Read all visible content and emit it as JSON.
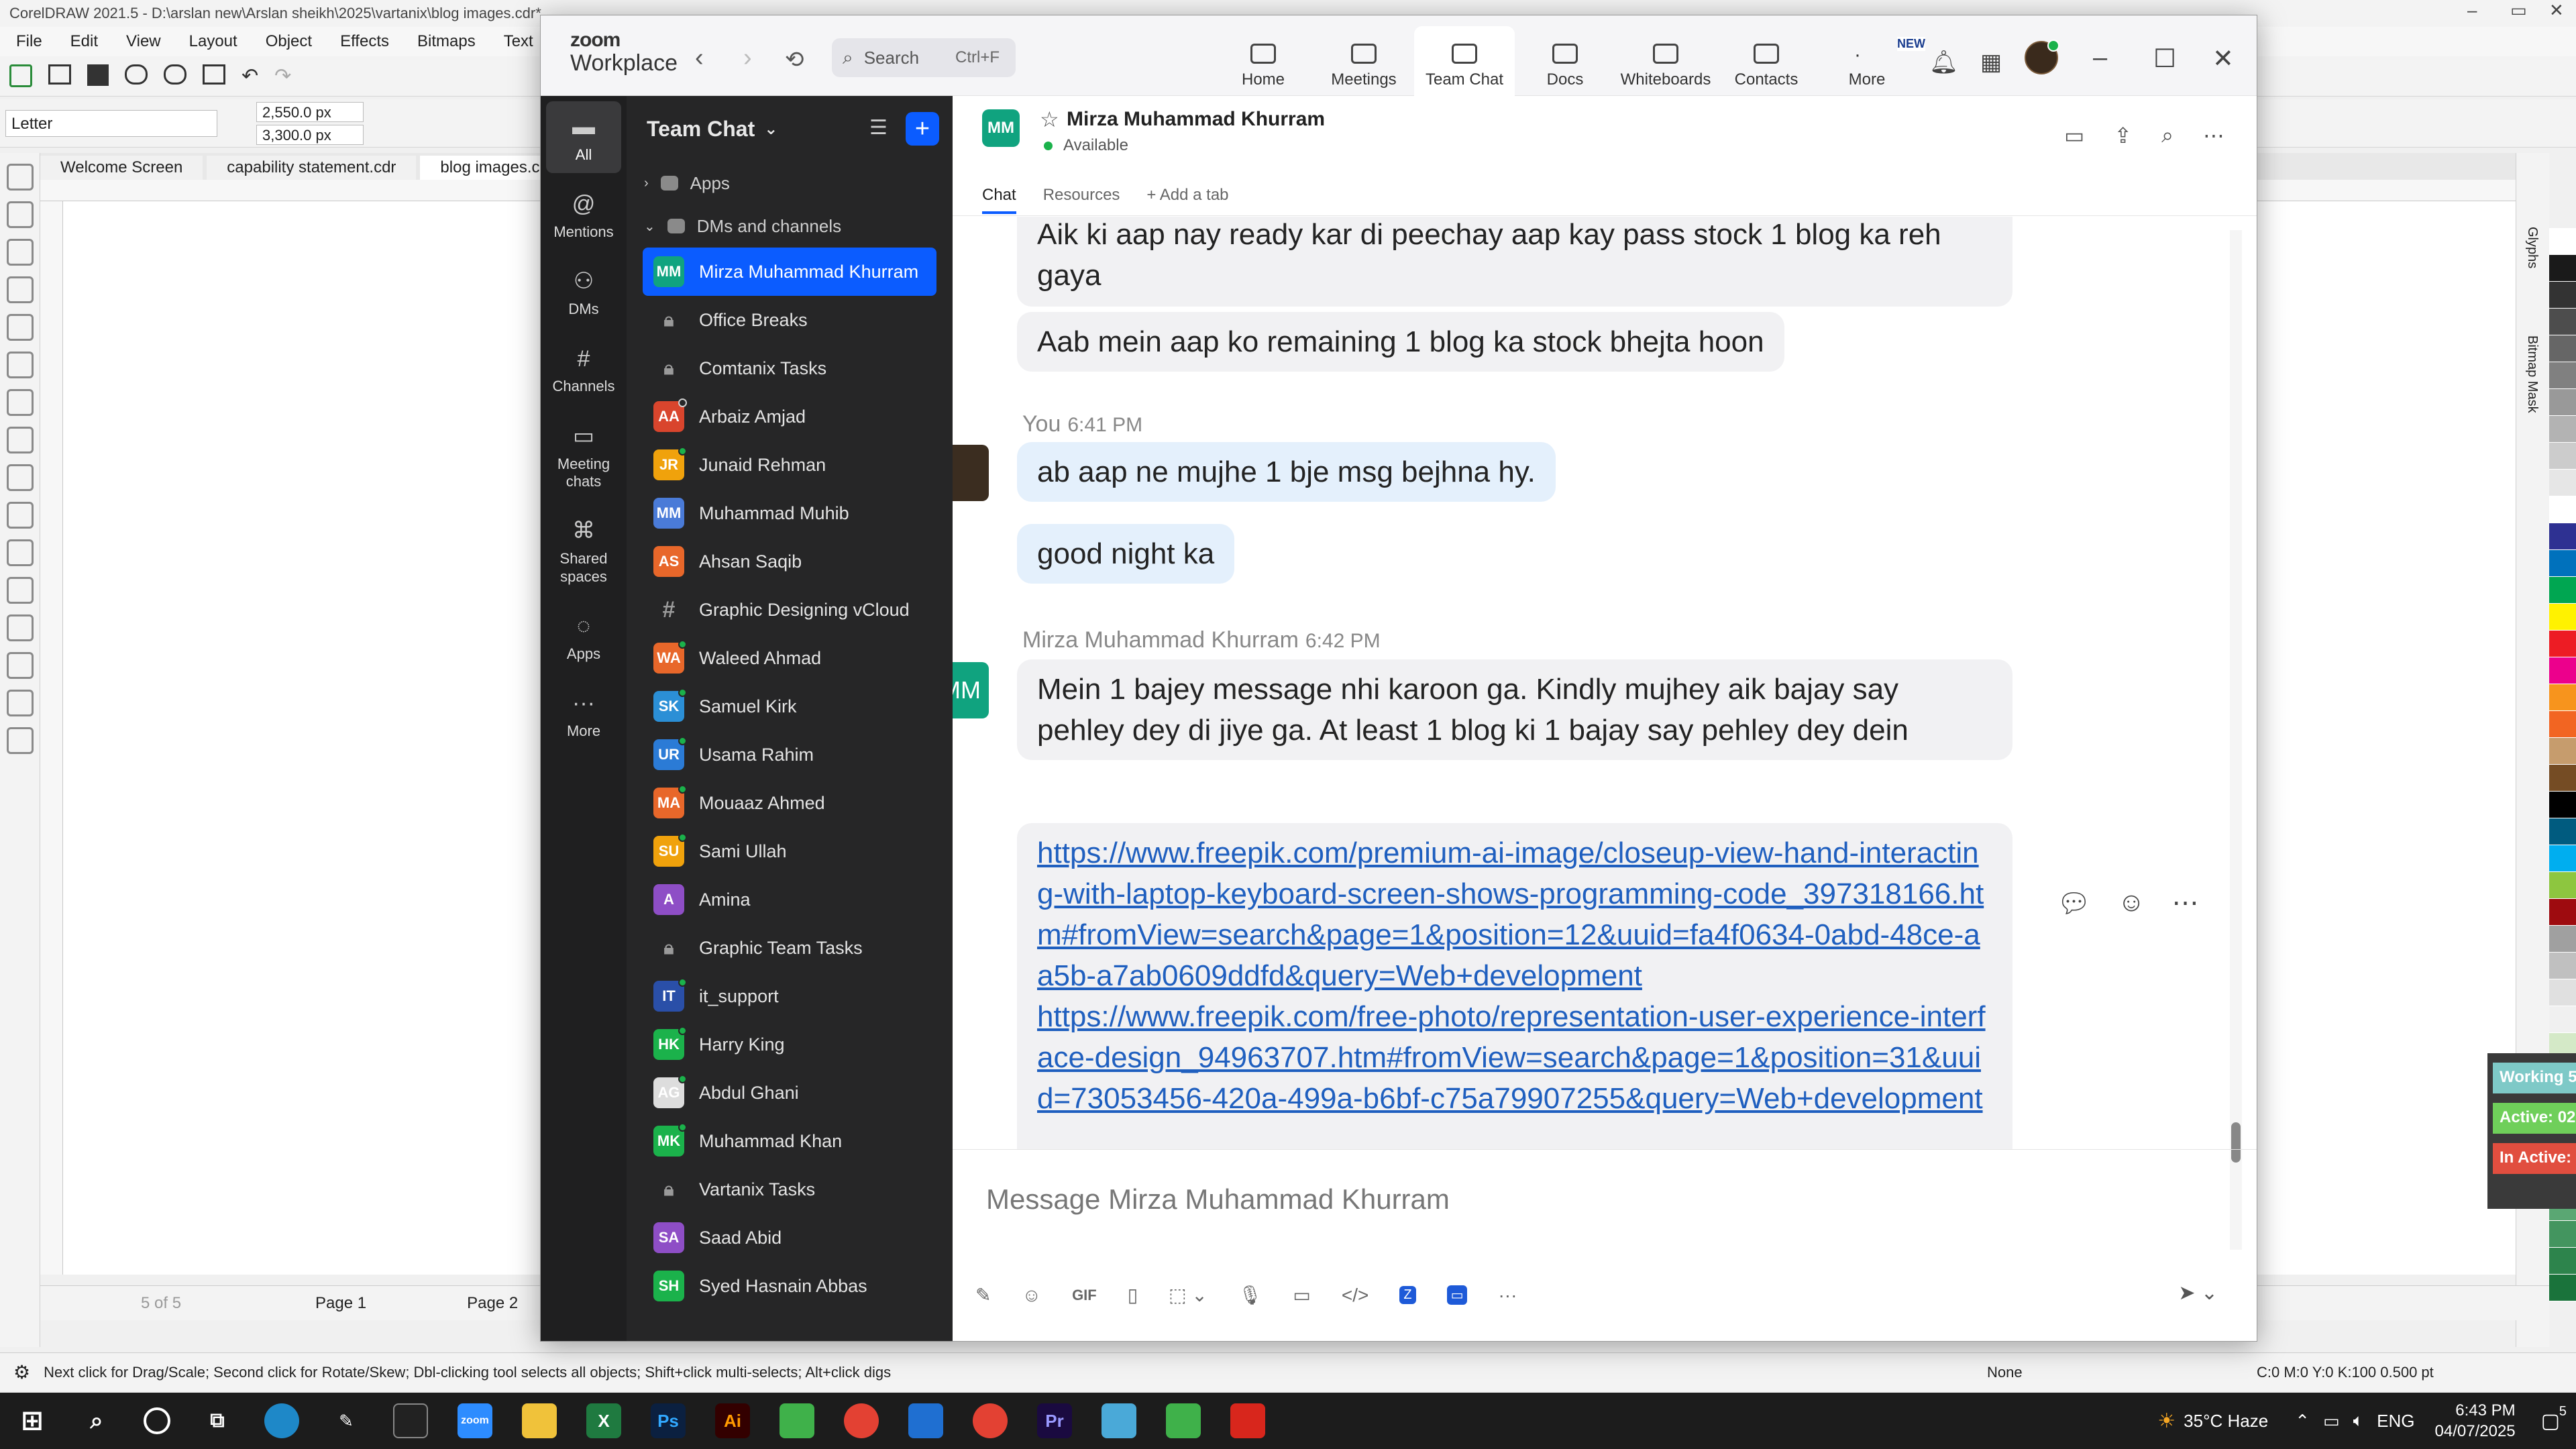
{
  "coreldraw": {
    "title": "CorelDRAW 2021.5 - D:\\arslan new\\Arslan sheikh\\2025\\vartanix\\blog images.cdr*",
    "menu": [
      "File",
      "Edit",
      "View",
      "Layout",
      "Object",
      "Effects",
      "Bitmaps",
      "Text"
    ],
    "page_size": "Letter",
    "width": "2,550.0 px",
    "height": "3,300.0 px",
    "tabs": [
      "Welcome Screen",
      "capability statement.cdr",
      "blog images.cdr*"
    ],
    "page_counter": "5 of 5",
    "page_tabs": [
      "Page 1",
      "Page 2"
    ],
    "status_hint": "Next click for Drag/Scale; Second click for Rotate/Skew; Dbl-clicking tool selects all objects; Shift+click multi-selects; Alt+click digs",
    "fill": "None",
    "outline": "C:0 M:0 Y:0 K:100  0.500 pt",
    "right_dock_labels": [
      "Glyphs",
      "Bitmap Mask"
    ],
    "palette_colors": [
      "#ffffff",
      "#1a1a1a",
      "#333333",
      "#4d4d4d",
      "#666666",
      "#808080",
      "#999999",
      "#b3b3b3",
      "#cccccc",
      "#e6e6e6",
      "#ffffff",
      "#2e3192",
      "#0071bc",
      "#00a651",
      "#fff200",
      "#ed1c24",
      "#ec008c",
      "#f7941d",
      "#f26522",
      "#c69c6d",
      "#754c24",
      "#000000",
      "#005b7f",
      "#00aeef",
      "#8dc63f",
      "#9e0b0f",
      "#a0a0a0",
      "#c0c0c0",
      "#e0e0e0",
      "#f0f0f0",
      "#d4e9c7",
      "#cfe6d0",
      "#b6dcd0",
      "#9bcfb8",
      "#8cc49f",
      "#73b889",
      "#5aa773",
      "#43955f",
      "#2d844c",
      "#1a733b"
    ],
    "floating_labels": [
      "Working 5",
      "Active: 02",
      "In Active:"
    ]
  },
  "taskbar": {
    "weather": "35°C Haze",
    "lang": "ENG",
    "time": "6:43 PM",
    "date": "04/07/2025",
    "notifications": "5",
    "apps": [
      "windows-start",
      "search",
      "cortana",
      "task-view",
      "edge",
      "pen",
      "terminal",
      "zoom",
      "explorer",
      "excel",
      "photoshop",
      "illustrator",
      "coreldraw",
      "chrome",
      "vscode",
      "chrome-profile",
      "premiere",
      "app",
      "corel-green",
      "acrobat"
    ]
  },
  "zoom": {
    "logo_top": "zoom",
    "logo_bottom": "Workplace",
    "search_label": "Search",
    "search_shortcut": "Ctrl+F",
    "nav": [
      {
        "label": "Home"
      },
      {
        "label": "Meetings"
      },
      {
        "label": "Team Chat"
      },
      {
        "label": "Docs"
      },
      {
        "label": "Whiteboards"
      },
      {
        "label": "Contacts"
      },
      {
        "label": "More"
      }
    ],
    "new_badge": "NEW",
    "rail": [
      {
        "label": "All",
        "icon": "chat-icon"
      },
      {
        "label": "Mentions",
        "icon": "at-icon"
      },
      {
        "label": "DMs",
        "icon": "people-icon"
      },
      {
        "label": "Channels",
        "icon": "hash-icon"
      },
      {
        "label": "Meeting chats",
        "icon": "calendar-icon"
      },
      {
        "label": "Shared spaces",
        "icon": "shared-icon"
      },
      {
        "label": "Apps",
        "icon": "apps-icon"
      },
      {
        "label": "More",
        "icon": "more-icon"
      }
    ],
    "list_title": "Team Chat",
    "sections": {
      "apps": "Apps",
      "dms": "DMs and channels"
    },
    "contacts": [
      {
        "name": "Mirza Muhammad Khurram",
        "initials": "MM",
        "color": "#10a37f",
        "kind": "avatar",
        "status": "none",
        "active": true
      },
      {
        "name": "Office Breaks",
        "kind": "lock"
      },
      {
        "name": "Comtanix Tasks",
        "kind": "lock"
      },
      {
        "name": "Arbaiz Amjad",
        "initials": "AA",
        "color": "#d9452d",
        "kind": "avatar",
        "status": "away"
      },
      {
        "name": "Junaid Rehman",
        "initials": "JR",
        "color": "#f0a20c",
        "kind": "avatar",
        "status": "online"
      },
      {
        "name": "Muhammad Muhib",
        "initials": "MM",
        "color": "#4a7bd8",
        "kind": "avatar",
        "status": "none"
      },
      {
        "name": "Ahsan Saqib",
        "initials": "AS",
        "color": "#e8672a",
        "kind": "avatar",
        "status": "none"
      },
      {
        "name": "Graphic Designing vCloud",
        "kind": "hash"
      },
      {
        "name": "Waleed Ahmad",
        "initials": "WA",
        "color": "#e8672a",
        "kind": "avatar",
        "status": "online"
      },
      {
        "name": "Samuel Kirk",
        "initials": "SK",
        "color": "#2b8fd6",
        "kind": "avatar",
        "status": "online"
      },
      {
        "name": "Usama Rahim",
        "initials": "UR",
        "color": "#2b7bd6",
        "kind": "avatar",
        "status": "online"
      },
      {
        "name": "Mouaaz Ahmed",
        "initials": "MA",
        "color": "#e8672a",
        "kind": "avatar",
        "status": "online"
      },
      {
        "name": "Sami Ullah",
        "initials": "SU",
        "color": "#f0a20c",
        "kind": "avatar",
        "status": "online"
      },
      {
        "name": "Amina",
        "initials": "A",
        "color": "#8e4ec6",
        "kind": "avatar",
        "status": "none"
      },
      {
        "name": "Graphic Team Tasks",
        "kind": "lock"
      },
      {
        "name": "it_support",
        "initials": "IT",
        "color": "#2a4fa8",
        "kind": "avatar",
        "status": "online"
      },
      {
        "name": "Harry King",
        "initials": "HK",
        "color": "#1bb24b",
        "kind": "avatar",
        "status": "online"
      },
      {
        "name": "Abdul Ghani",
        "initials": "AG",
        "color": "#dddddd",
        "kind": "avatar",
        "status": "online"
      },
      {
        "name": "Muhammad Khan",
        "initials": "MK",
        "color": "#1bb24b",
        "kind": "avatar",
        "status": "online"
      },
      {
        "name": "Vartanix Tasks",
        "kind": "lock"
      },
      {
        "name": "Saad Abid",
        "initials": "SA",
        "color": "#8e4ec6",
        "kind": "avatar",
        "status": "none"
      },
      {
        "name": "Syed Hasnain Abbas",
        "initials": "SH",
        "color": "#1bb24b",
        "kind": "avatar",
        "status": "none"
      }
    ],
    "chat": {
      "header_initials": "MM",
      "header_name": "Mirza Muhammad Khurram",
      "header_status": "Available",
      "tabs": [
        "Chat",
        "Resources",
        "+ Add a tab"
      ],
      "messages": {
        "m1": "Aik ki aap nay ready kar di peechay aap kay pass stock 1 blog ka reh gaya",
        "m2": "Aab mein aap ko remaining 1 blog ka stock bhejta hoon",
        "you_name": "You",
        "you_time": "6:41 PM",
        "m3": "ab aap ne mujhe 1 bje msg bejhna hy.",
        "m4": "good night ka",
        "other_name": "Mirza Muhammad Khurram",
        "other_time": "6:42 PM",
        "other_initials": "MM",
        "m5": "Mein 1 bajey message nhi karoon ga. Kindly mujhey aik bajay say pehley dey di jiye ga. At least 1 blog ki 1 bajay say pehley dey dein",
        "link1": "https://www.freepik.com/premium-ai-image/closeup-view-hand-interacting-with-laptop-keyboard-screen-shows-programming-code_397318166.htm#fromView=search&page=1&position=12&uuid=fa4f0634-0abd-48ce-aa5b-a7ab0609ddfd&query=Web+development",
        "link2": "https://www.freepik.com/free-photo/representation-user-experience-interface-design_94963707.htm#fromView=search&page=1&position=31&uuid=73053456-420a-499a-b6bf-c75a79907255&query=Web+development"
      },
      "input_placeholder": "Message Mirza Muhammad Khurram"
    }
  }
}
